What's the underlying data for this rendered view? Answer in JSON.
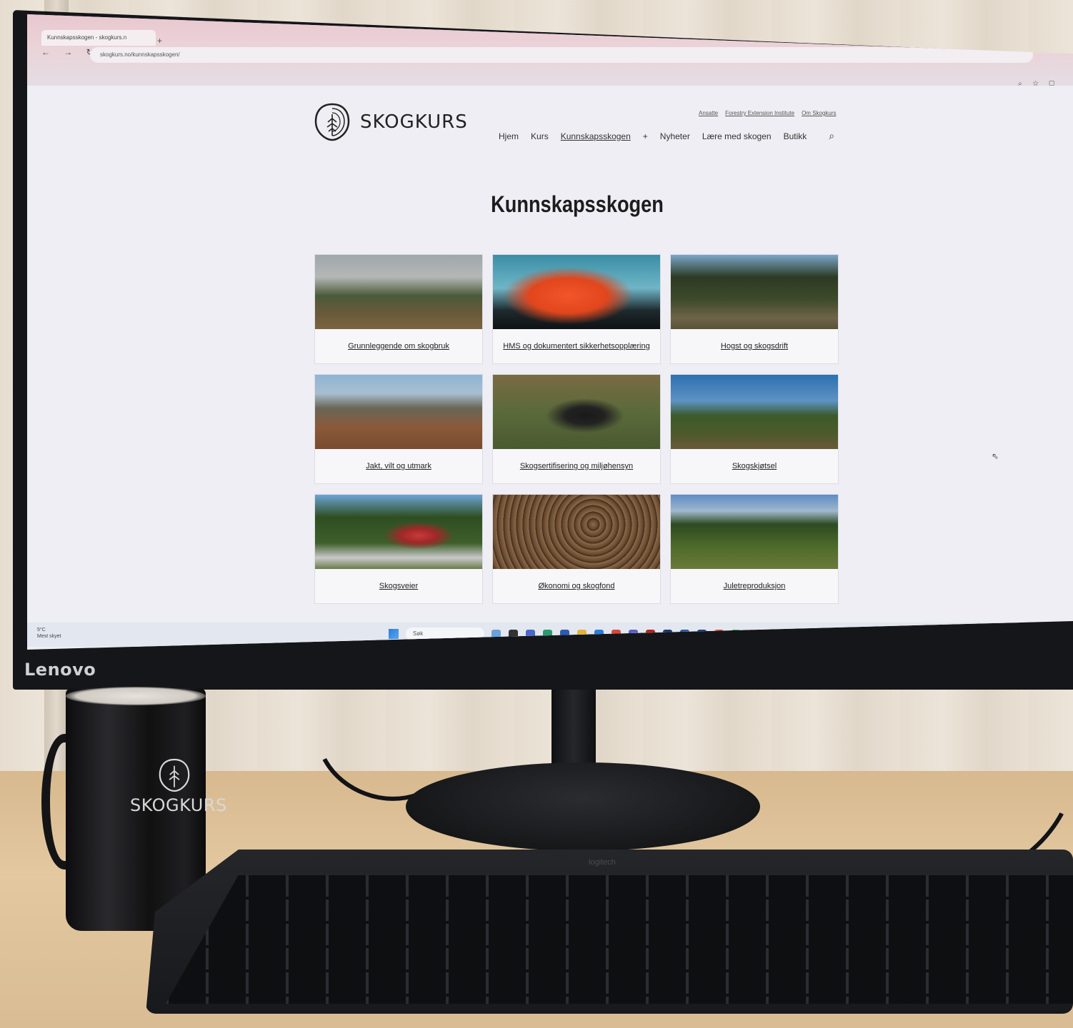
{
  "browser": {
    "tab_title": "Kunnskapsskogen - skogkurs.n",
    "url": "skogkurs.no/kunnskapsskogen/"
  },
  "site": {
    "logo_text": "SKOGKURS",
    "top_links": [
      "Ansatte",
      "Forestry Extension Institute",
      "Om Skogkurs"
    ],
    "nav": [
      "Hjem",
      "Kurs",
      "Kunnskapsskogen",
      "+",
      "Nyheter",
      "Lære med skogen",
      "Butikk"
    ],
    "active_nav": "Kunnskapsskogen",
    "page_title": "Kunnskapsskogen"
  },
  "cards": [
    {
      "label": "Grunnleggende om skogbruk"
    },
    {
      "label": "HMS og dokumentert sikkerhetsopplæring"
    },
    {
      "label": "Hogst og skogsdrift"
    },
    {
      "label": "Jakt, vilt og utmark"
    },
    {
      "label": "Skogsertifisering og miljøhensyn"
    },
    {
      "label": "Skogskjøtsel"
    },
    {
      "label": "Skogsveier"
    },
    {
      "label": "Økonomi og skogfond"
    },
    {
      "label": "Juletreproduksjon"
    }
  ],
  "taskbar": {
    "weather_temp": "5°C",
    "weather_desc": "Mest skyet",
    "search_placeholder": "Søk"
  },
  "monitor_brand": "Lenovo",
  "mug_text": "SKOGKURS",
  "keyboard_brand": "logitech"
}
